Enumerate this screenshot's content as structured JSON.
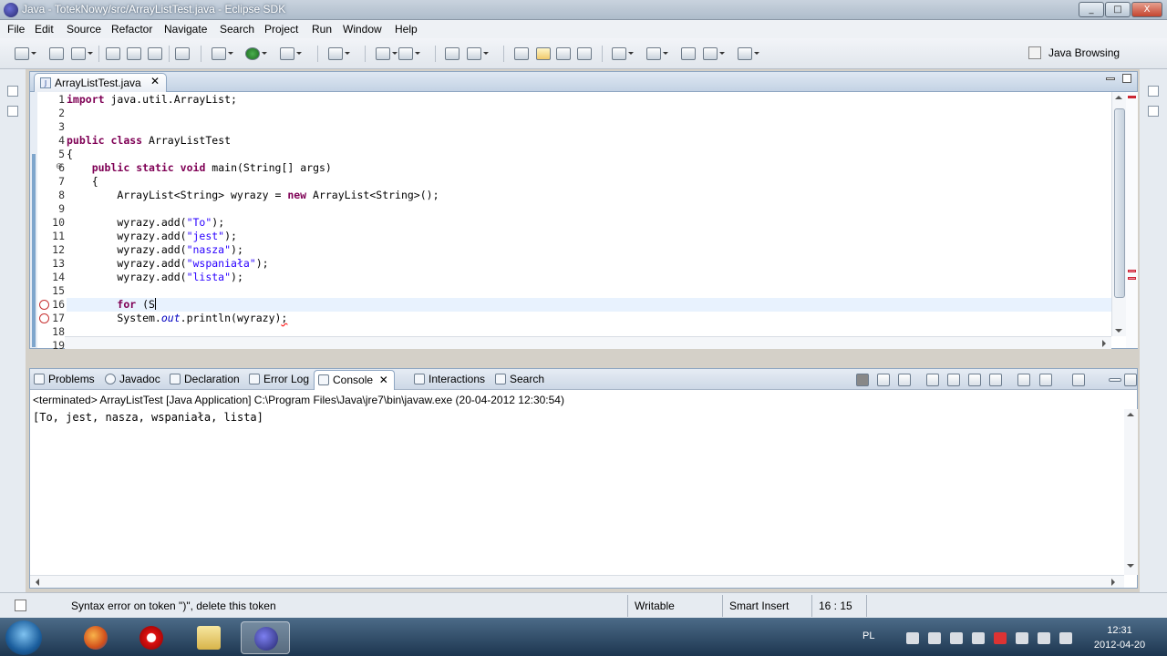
{
  "window": {
    "title": "Java - TotekNowy/src/ArrayListTest.java - Eclipse SDK",
    "min_label": "_",
    "max_label": "□",
    "close_label": "X"
  },
  "menu": [
    "File",
    "Edit",
    "Source",
    "Refactor",
    "Navigate",
    "Search",
    "Project",
    "Run",
    "Window",
    "Help"
  ],
  "perspective": {
    "label": "Java Browsing"
  },
  "editor": {
    "tab_label": "ArrayListTest.java",
    "tab_close": "✕",
    "current_line": 16,
    "error_lines": [
      16,
      17
    ],
    "line_numbers": [
      "1",
      "2",
      "3",
      "4",
      "5",
      "6",
      "7",
      "8",
      "9",
      "10",
      "11",
      "12",
      "13",
      "14",
      "15",
      "16",
      "17",
      "18",
      "19"
    ],
    "lines": [
      "import java.util.ArrayList;",
      "",
      "",
      "public class ArrayListTest",
      "{",
      "    public static void main(String[] args)",
      "    {",
      "        ArrayList<String> wyrazy = new ArrayList<String>();",
      "",
      "        wyrazy.add(\"To\");",
      "        wyrazy.add(\"jest\");",
      "        wyrazy.add(\"nasza\");",
      "        wyrazy.add(\"wspaniała\");",
      "        wyrazy.add(\"lista\");",
      "",
      "        for (S",
      "        System.out.println(wyrazy);",
      "",
      "    }"
    ]
  },
  "console": {
    "tabs": [
      "Problems",
      "Javadoc",
      "Declaration",
      "Error Log",
      "Console",
      "Interactions",
      "Search"
    ],
    "active_tab": "Console",
    "close_mark": "✕",
    "status": "<terminated> ArrayListTest [Java Application] C:\\Program Files\\Java\\jre7\\bin\\javaw.exe (20-04-2012 12:30:54)",
    "output": "[To, jest, nasza, wspaniała, lista]"
  },
  "statusbar": {
    "message": "Syntax error on token \")\", delete this token",
    "writable": "Writable",
    "insert_mode": "Smart Insert",
    "position": "16 : 15"
  },
  "taskbar": {
    "lang": "PL",
    "time": "12:31",
    "date": "2012-04-20"
  },
  "colors": {
    "keyword": "#7f0055",
    "string": "#2a00ff",
    "error": "#c83232"
  }
}
